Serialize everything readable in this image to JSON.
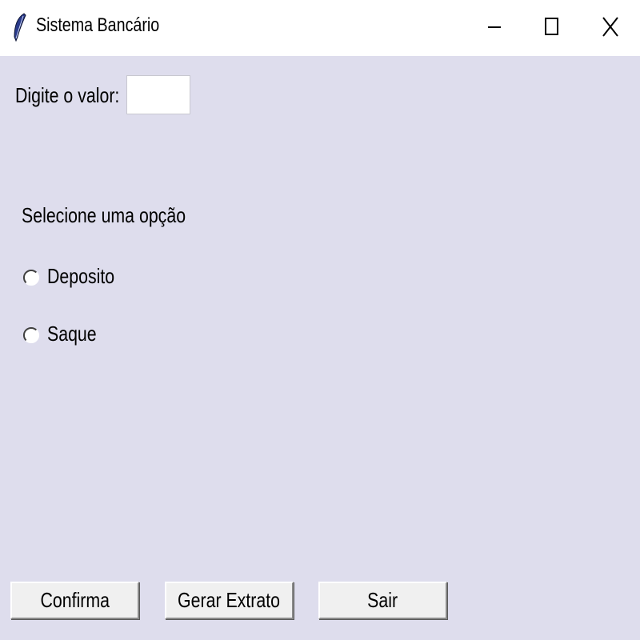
{
  "window": {
    "title": "Sistema Bancário",
    "icon": "feather-icon",
    "controls": [
      "minimize-icon",
      "maximize-icon",
      "close-icon"
    ]
  },
  "form": {
    "value_label": "Digite o valor:",
    "value_input": "",
    "options_label": "Selecione uma opção",
    "options": [
      {
        "label": "Deposito",
        "selected": false
      },
      {
        "label": "Saque",
        "selected": false
      }
    ]
  },
  "buttons": {
    "confirm": "Confirma",
    "statement": "Gerar Extrato",
    "exit": "Sair"
  },
  "colors": {
    "background": "#dedded",
    "titlebar": "#ffffff",
    "button_face": "#f0f0f0"
  }
}
